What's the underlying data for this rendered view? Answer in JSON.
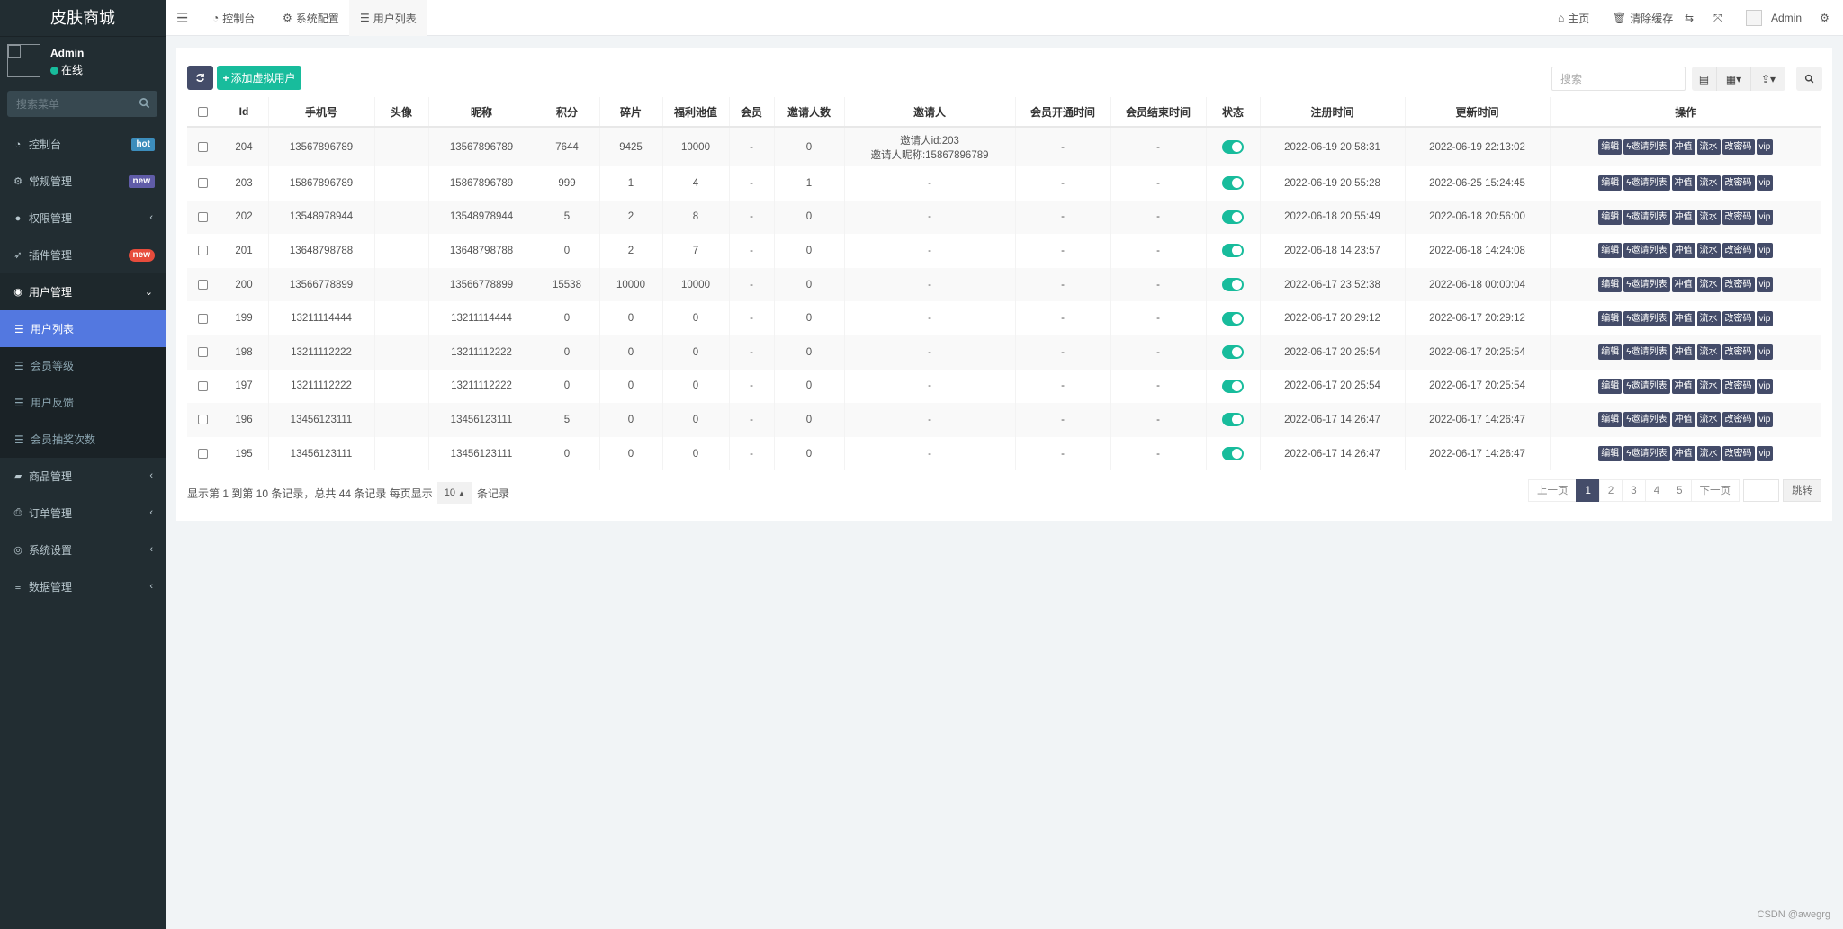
{
  "sidebar": {
    "brand": "皮肤商城",
    "user": {
      "name": "Admin",
      "status": "在线"
    },
    "search_placeholder": "搜索菜单",
    "menu": [
      {
        "label": "控制台",
        "icon": "dashboard-icon",
        "badge": "hot",
        "badge_color": "#3c8dbc"
      },
      {
        "label": "常规管理",
        "icon": "cogs-icon",
        "badge": "new",
        "badge_color": "#605ca8"
      },
      {
        "label": "权限管理",
        "icon": "group-icon",
        "arrow": "‹"
      },
      {
        "label": "插件管理",
        "icon": "rocket-icon",
        "badge": "new",
        "badge_color": "#e74c3c"
      },
      {
        "label": "用户管理",
        "icon": "user-circle-icon",
        "arrow": "⌄",
        "open": true
      }
    ],
    "submenu": [
      {
        "label": "用户列表",
        "active": true
      },
      {
        "label": "会员等级"
      },
      {
        "label": "用户反馈"
      },
      {
        "label": "会员抽奖次数"
      }
    ],
    "menu_after": [
      {
        "label": "商品管理",
        "icon": "shopping-bag-icon",
        "arrow": "‹"
      },
      {
        "label": "订单管理",
        "icon": "print-icon",
        "arrow": "‹"
      },
      {
        "label": "系统设置",
        "icon": "life-ring-icon",
        "arrow": "‹"
      },
      {
        "label": "数据管理",
        "icon": "database-icon",
        "arrow": "‹"
      }
    ]
  },
  "topbar": {
    "tabs": [
      {
        "label": "控制台"
      },
      {
        "label": "系统配置"
      },
      {
        "label": "用户列表",
        "active": true
      }
    ],
    "right": {
      "home": "主页",
      "clear_cache": "清除缓存",
      "admin": "Admin"
    }
  },
  "toolbar": {
    "add_label": "添加虚拟用户",
    "search_placeholder": "搜索"
  },
  "table": {
    "headers": [
      "Id",
      "手机号",
      "头像",
      "昵称",
      "积分",
      "碎片",
      "福利池值",
      "会员",
      "邀请人数",
      "邀请人",
      "会员开通时间",
      "会员结束时间",
      "状态",
      "注册时间",
      "更新时间",
      "操作"
    ],
    "actions": [
      "编辑",
      "邀请列表",
      "冲值",
      "流水",
      "改密码",
      "vip"
    ],
    "rows": [
      {
        "id": "204",
        "phone": "13567896789",
        "avatar": "",
        "nickname": "13567896789",
        "points": "7644",
        "fragments": "9425",
        "pool": "10000",
        "vip": "-",
        "invites": "0",
        "inviter": "邀请人id:203",
        "inviter2": "邀请人昵称:15867896789",
        "vip_start": "-",
        "vip_end": "-",
        "status": true,
        "created": "2022-06-19 20:58:31",
        "updated": "2022-06-19 22:13:02"
      },
      {
        "id": "203",
        "phone": "15867896789",
        "avatar": "",
        "nickname": "15867896789",
        "points": "999",
        "fragments": "1",
        "pool": "4",
        "vip": "-",
        "invites": "1",
        "inviter": "-",
        "inviter2": "",
        "vip_start": "-",
        "vip_end": "-",
        "status": true,
        "created": "2022-06-19 20:55:28",
        "updated": "2022-06-25 15:24:45"
      },
      {
        "id": "202",
        "phone": "13548978944",
        "avatar": "",
        "nickname": "13548978944",
        "points": "5",
        "fragments": "2",
        "pool": "8",
        "vip": "-",
        "invites": "0",
        "inviter": "-",
        "inviter2": "",
        "vip_start": "-",
        "vip_end": "-",
        "status": true,
        "created": "2022-06-18 20:55:49",
        "updated": "2022-06-18 20:56:00"
      },
      {
        "id": "201",
        "phone": "13648798788",
        "avatar": "",
        "nickname": "13648798788",
        "points": "0",
        "fragments": "2",
        "pool": "7",
        "vip": "-",
        "invites": "0",
        "inviter": "-",
        "inviter2": "",
        "vip_start": "-",
        "vip_end": "-",
        "status": true,
        "created": "2022-06-18 14:23:57",
        "updated": "2022-06-18 14:24:08"
      },
      {
        "id": "200",
        "phone": "13566778899",
        "avatar": "",
        "nickname": "13566778899",
        "points": "15538",
        "fragments": "10000",
        "pool": "10000",
        "vip": "-",
        "invites": "0",
        "inviter": "-",
        "inviter2": "",
        "vip_start": "-",
        "vip_end": "-",
        "status": true,
        "created": "2022-06-17 23:52:38",
        "updated": "2022-06-18 00:00:04"
      },
      {
        "id": "199",
        "phone": "13211114444",
        "avatar": "",
        "nickname": "13211114444",
        "points": "0",
        "fragments": "0",
        "pool": "0",
        "vip": "-",
        "invites": "0",
        "inviter": "-",
        "inviter2": "",
        "vip_start": "-",
        "vip_end": "-",
        "status": true,
        "created": "2022-06-17 20:29:12",
        "updated": "2022-06-17 20:29:12"
      },
      {
        "id": "198",
        "phone": "13211112222",
        "avatar": "",
        "nickname": "13211112222",
        "points": "0",
        "fragments": "0",
        "pool": "0",
        "vip": "-",
        "invites": "0",
        "inviter": "-",
        "inviter2": "",
        "vip_start": "-",
        "vip_end": "-",
        "status": true,
        "created": "2022-06-17 20:25:54",
        "updated": "2022-06-17 20:25:54"
      },
      {
        "id": "197",
        "phone": "13211112222",
        "avatar": "",
        "nickname": "13211112222",
        "points": "0",
        "fragments": "0",
        "pool": "0",
        "vip": "-",
        "invites": "0",
        "inviter": "-",
        "inviter2": "",
        "vip_start": "-",
        "vip_end": "-",
        "status": true,
        "created": "2022-06-17 20:25:54",
        "updated": "2022-06-17 20:25:54"
      },
      {
        "id": "196",
        "phone": "13456123111",
        "avatar": "",
        "nickname": "13456123111",
        "points": "5",
        "fragments": "0",
        "pool": "0",
        "vip": "-",
        "invites": "0",
        "inviter": "-",
        "inviter2": "",
        "vip_start": "-",
        "vip_end": "-",
        "status": true,
        "created": "2022-06-17 14:26:47",
        "updated": "2022-06-17 14:26:47"
      },
      {
        "id": "195",
        "phone": "13456123111",
        "avatar": "",
        "nickname": "13456123111",
        "points": "0",
        "fragments": "0",
        "pool": "0",
        "vip": "-",
        "invites": "0",
        "inviter": "-",
        "inviter2": "",
        "vip_start": "-",
        "vip_end": "-",
        "status": true,
        "created": "2022-06-17 14:26:47",
        "updated": "2022-06-17 14:26:47"
      }
    ]
  },
  "pagination": {
    "info_prefix": "显示第 1 到第 10 条记录，总共 44 条记录 每页显示",
    "page_size": "10",
    "info_suffix": "条记录",
    "prev": "上一页",
    "pages": [
      "1",
      "2",
      "3",
      "4",
      "5"
    ],
    "current": "1",
    "next": "下一页",
    "jump": "跳转"
  },
  "colors": {
    "accent": "#444c69",
    "success": "#18bc9c",
    "sidebar_active": "#5378e0"
  },
  "watermark": "CSDN @awegrg"
}
